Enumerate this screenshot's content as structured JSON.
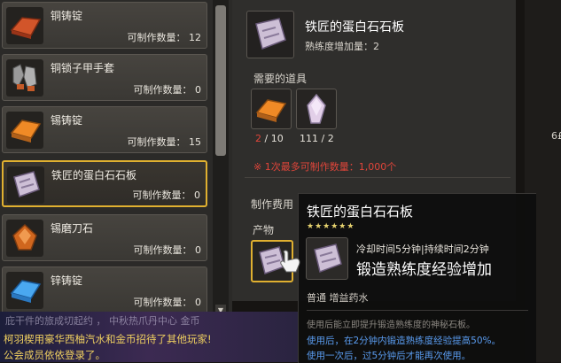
{
  "recipes": [
    {
      "name": "铜铸锭",
      "count_label": "可制作数量：",
      "count": "12"
    },
    {
      "name": "铜锁子甲手套",
      "count_label": "可制作数量：",
      "count": "0"
    },
    {
      "name": "锡铸锭",
      "count_label": "可制作数量：",
      "count": "15"
    },
    {
      "name": "铁匠的蛋白石石板",
      "count_label": "可制作数量：",
      "count": "0"
    },
    {
      "name": "锡磨刀石",
      "count_label": "可制作数量：",
      "count": "0"
    },
    {
      "name": "锌铸锭",
      "count_label": "可制作数量：",
      "count": "0"
    }
  ],
  "detail": {
    "title": "铁匠的蛋白石石板",
    "proficiency": "熟练度增加量：2",
    "needed_label": "需要的道具",
    "materials": [
      {
        "have": "2",
        "sep": " / ",
        "need": "10",
        "icon": "bronze-ingot-icon"
      },
      {
        "have": "111",
        "sep": " / ",
        "need": "2",
        "icon": "opal-crystal-icon"
      }
    ],
    "note": "※ 1次最多可制作数量：1,000个",
    "fee_label": "制作费用",
    "product_label": "产物"
  },
  "edge_number": "6£",
  "tooltip": {
    "title": "铁匠的蛋白石石板",
    "stars": "★★★★★★",
    "cooldown": "冷却时间5分钟|持续时间2分钟",
    "effect": "锻造熟练度经验增加",
    "category": "普通  增益药水",
    "desc": "使用后能立即提升锻造熟练度的神秘石板。",
    "line1": "使用后，在2分钟内锻造熟练度经验提高50%。",
    "line2": "使用一次后，过5分钟后才能再次使用。"
  },
  "chat": {
    "partial": "庇干件的旅成切起约  ，  中秋热爪丹中心  金币",
    "line1": "柯羽楔用豪华西柚汽水和金币招待了其他玩家!",
    "line2": "公会成员依依登录了。"
  },
  "colors": {
    "selected_border": "#e0b030",
    "warn": "#e0453a",
    "info_blue": "#5a9cf0",
    "chat_yellow": "#f0d060"
  }
}
